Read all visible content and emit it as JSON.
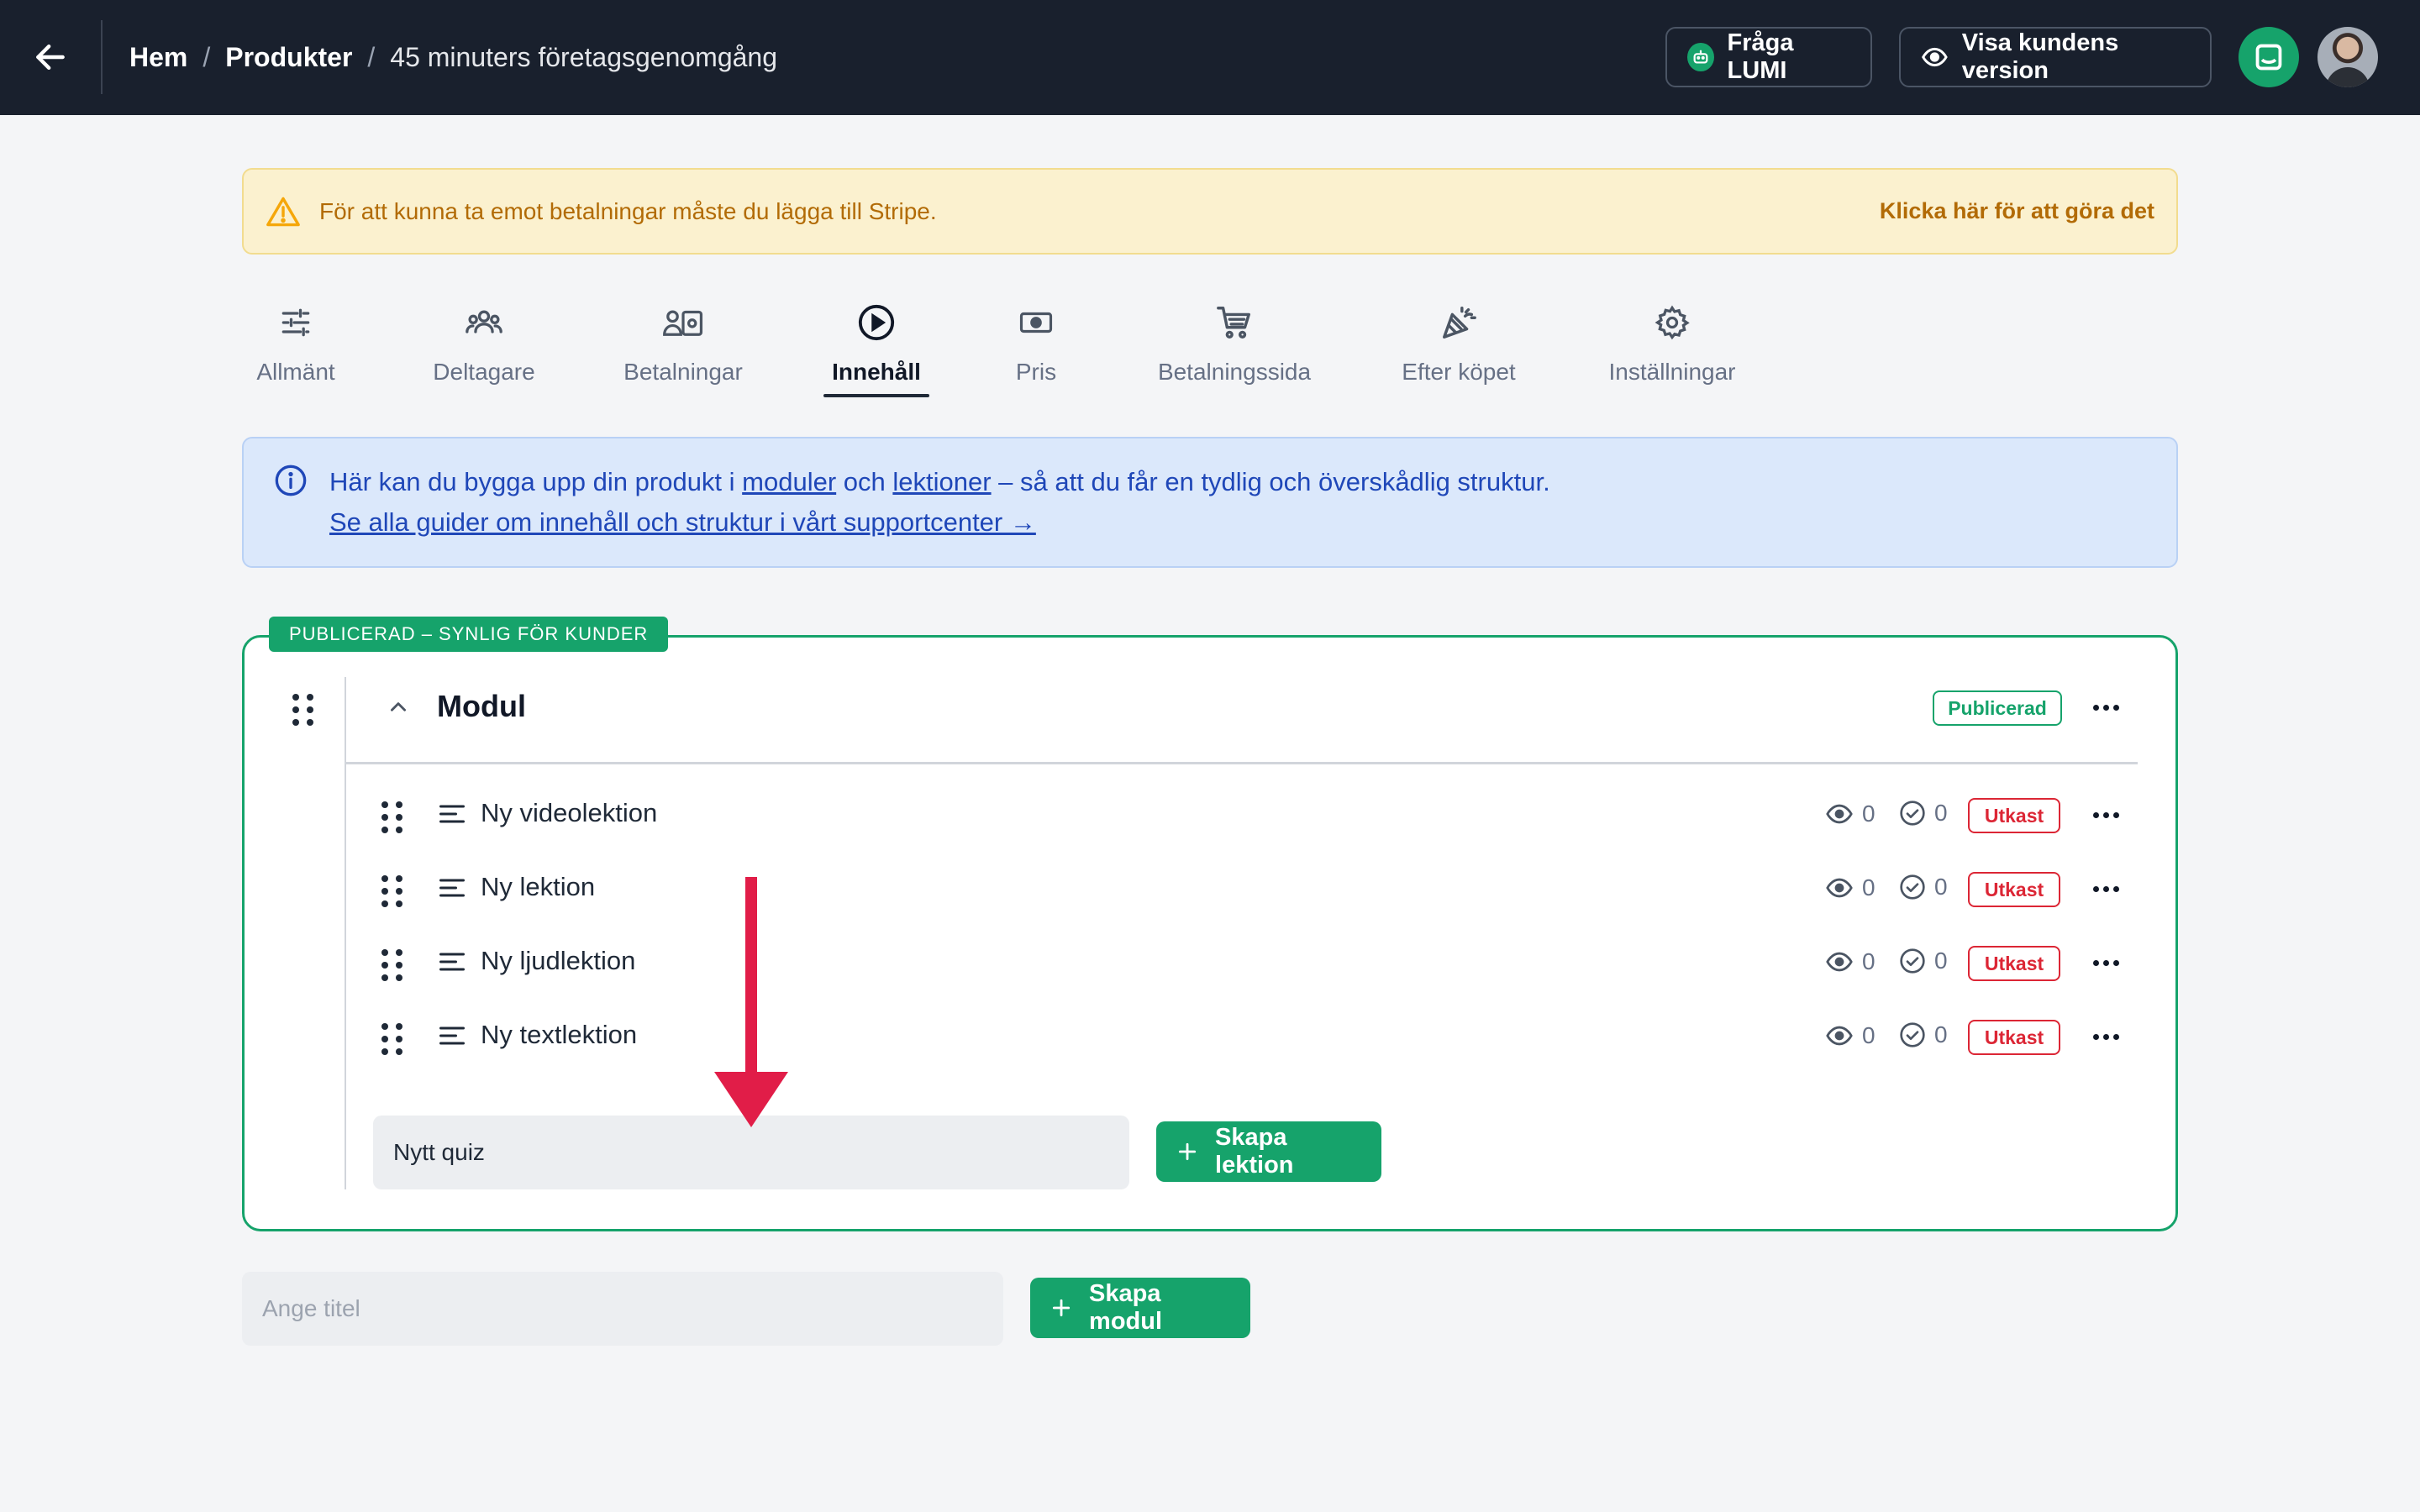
{
  "topbar": {
    "breadcrumb": {
      "home": "Hem",
      "sep1": "/",
      "products": "Produkter",
      "sep2": "/",
      "current": "45 minuters företagsgenomgång"
    },
    "ask_lumi_label": "Fråga LUMI",
    "customer_view_label": "Visa kundens version"
  },
  "warning": {
    "text": "För att kunna ta emot betalningar måste du lägga till Stripe.",
    "link": "Klicka här för att göra det"
  },
  "tabs": [
    {
      "label": "Allmänt",
      "icon": "sliders-icon"
    },
    {
      "label": "Deltagare",
      "icon": "users-icon"
    },
    {
      "label": "Betalningar",
      "icon": "payments-icon"
    },
    {
      "label": "Innehåll",
      "icon": "play-circle-icon",
      "active": true
    },
    {
      "label": "Pris",
      "icon": "banknote-icon"
    },
    {
      "label": "Betalningssida",
      "icon": "cart-icon"
    },
    {
      "label": "Efter köpet",
      "icon": "party-popper-icon"
    },
    {
      "label": "Inställningar",
      "icon": "gear-icon"
    }
  ],
  "info": {
    "text_before": "Här kan du bygga upp din produkt i ",
    "link_modules": "moduler",
    "text_och": " och ",
    "link_lessons": "lektioner",
    "text_after": " – så att du får en tydlig och överskådlig struktur.",
    "guide_link": "Se alla guider om innehåll och struktur i vårt supportcenter →"
  },
  "module": {
    "banner": "PUBLICERAD – SYNLIG FÖR KUNDER",
    "title": "Modul",
    "status": "Publicerad",
    "lessons": [
      {
        "title": "Ny videolektion",
        "views": "0",
        "completions": "0",
        "status": "Utkast"
      },
      {
        "title": "Ny lektion",
        "views": "0",
        "completions": "0",
        "status": "Utkast"
      },
      {
        "title": "Ny ljudlektion",
        "views": "0",
        "completions": "0",
        "status": "Utkast"
      },
      {
        "title": "Ny textlektion",
        "views": "0",
        "completions": "0",
        "status": "Utkast"
      }
    ],
    "new_lesson_value": "Nytt quiz",
    "create_lesson_label": "Skapa lektion"
  },
  "new_module": {
    "placeholder": "Ange titel",
    "create_label": "Skapa modul"
  },
  "colors": {
    "topbar_bg": "#19202d",
    "accent_green": "#16a36b",
    "draft_red": "#dc2635",
    "warning_bg": "#fbf1cf",
    "info_bg": "#dbe8fb",
    "annotation_arrow": "#e11d48"
  }
}
